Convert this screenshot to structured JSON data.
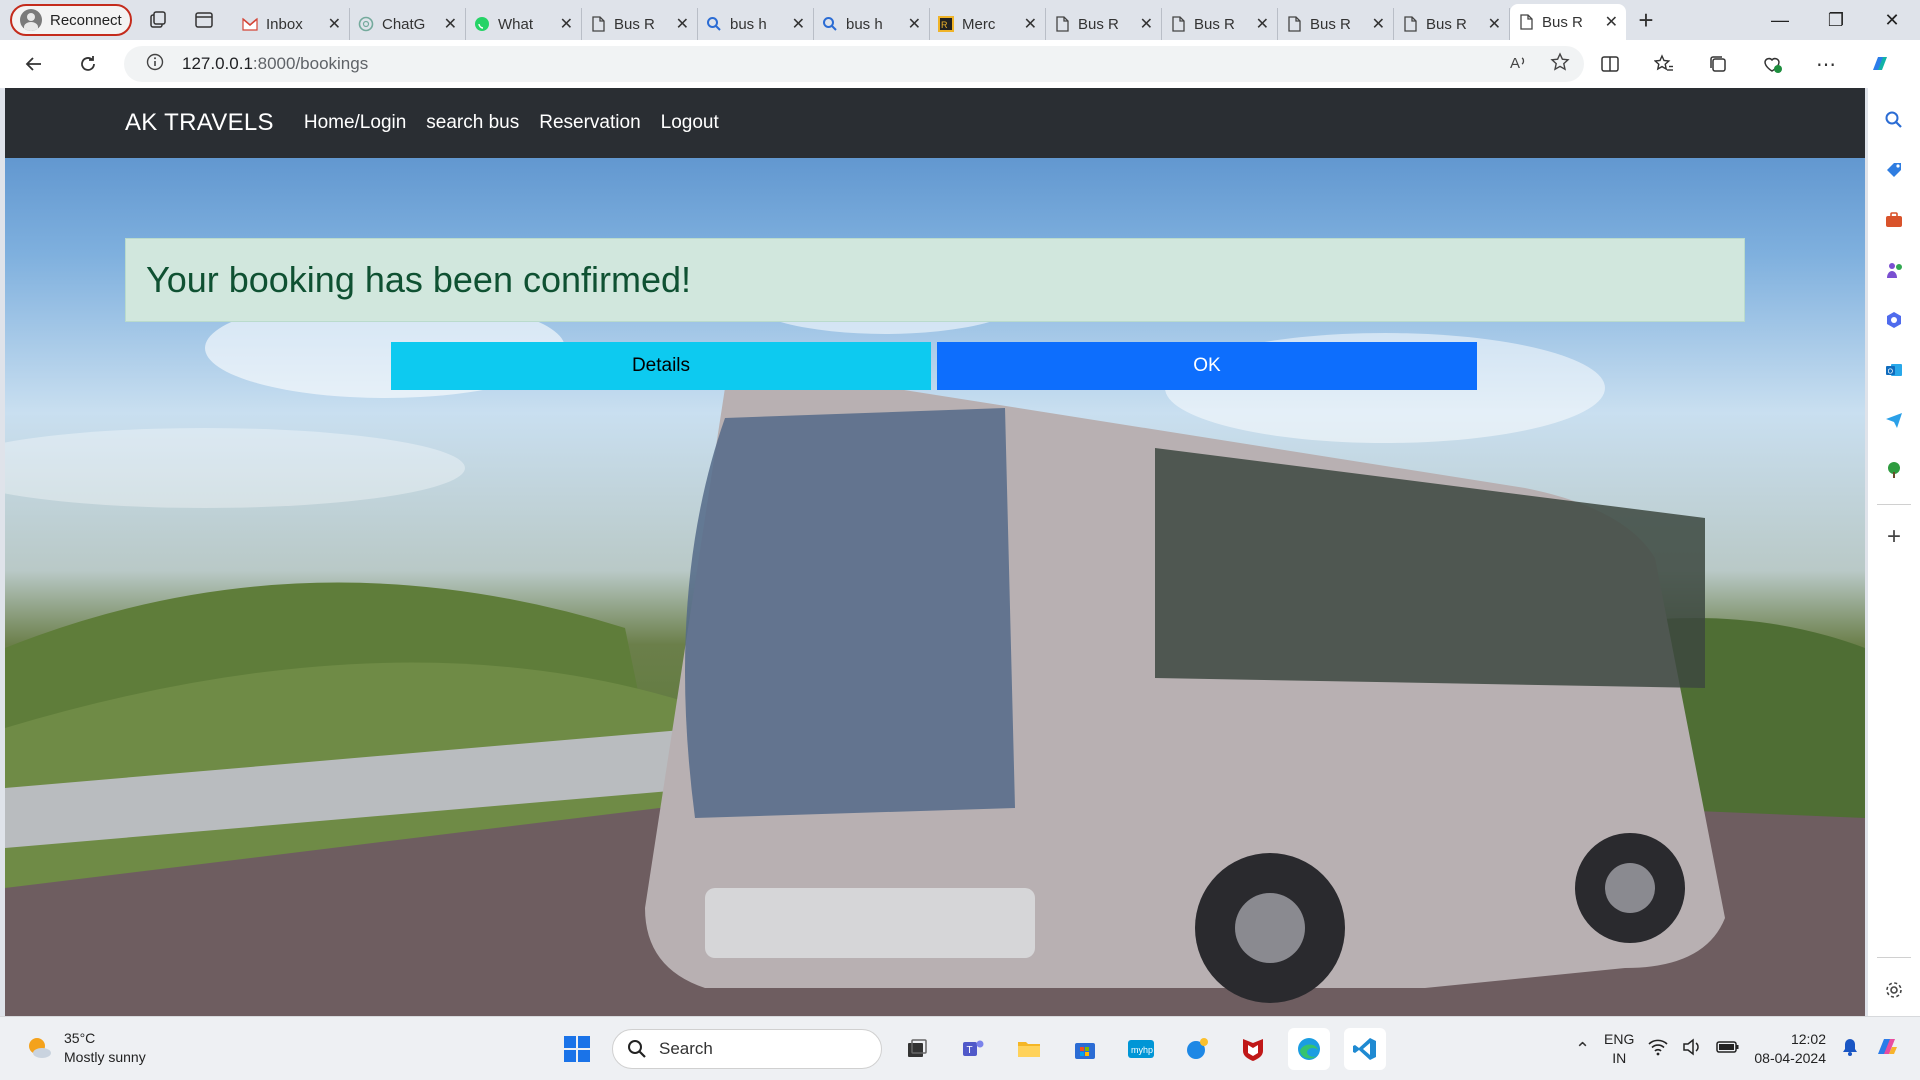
{
  "browser": {
    "profile_label": "Reconnect",
    "tabs": [
      {
        "title": "Inbox",
        "icon": "gmail-icon"
      },
      {
        "title": "ChatG",
        "icon": "chatgpt-icon"
      },
      {
        "title": "What",
        "icon": "whatsapp-icon"
      },
      {
        "title": "Bus R",
        "icon": "page-icon"
      },
      {
        "title": "bus h",
        "icon": "search-icon"
      },
      {
        "title": "bus h",
        "icon": "search-icon"
      },
      {
        "title": "Merc",
        "icon": "site-logo-icon"
      },
      {
        "title": "Bus R",
        "icon": "page-icon"
      },
      {
        "title": "Bus R",
        "icon": "page-icon"
      },
      {
        "title": "Bus R",
        "icon": "page-icon"
      },
      {
        "title": "Bus R",
        "icon": "page-icon"
      },
      {
        "title": "Bus R",
        "icon": "page-icon",
        "active": true
      }
    ],
    "url_host": "127.0.0.1",
    "url_path": ":8000/bookings"
  },
  "page": {
    "brand": "AK TRAVELS",
    "nav": [
      "Home/Login",
      "search bus",
      "Reservation",
      "Logout"
    ],
    "alert": "Your booking has been confirmed!",
    "details_label": "Details",
    "ok_label": "OK"
  },
  "taskbar": {
    "temperature": "35°C",
    "weather": "Mostly sunny",
    "search_placeholder": "Search",
    "lang_top": "ENG",
    "lang_bottom": "IN",
    "time": "12:02",
    "date": "08-04-2024"
  },
  "colors": {
    "navbar": "#2a2e33",
    "alert_bg": "#d1e7dd",
    "alert_text": "#0f5132",
    "details_btn": "#0dcaf0",
    "ok_btn": "#0d6efd"
  }
}
